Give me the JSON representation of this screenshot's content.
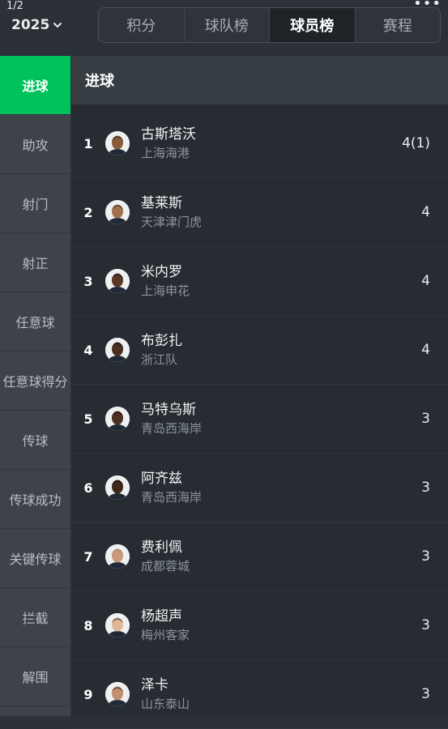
{
  "status": {
    "pager": "1/2",
    "more": "•••"
  },
  "season": {
    "year": "2025"
  },
  "tabs": [
    {
      "label": "积分"
    },
    {
      "label": "球队榜"
    },
    {
      "label": "球员榜"
    },
    {
      "label": "赛程"
    }
  ],
  "sidebar": {
    "items": [
      {
        "label": "进球"
      },
      {
        "label": "助攻"
      },
      {
        "label": "射门"
      },
      {
        "label": "射正"
      },
      {
        "label": "任意球"
      },
      {
        "label": "任意球得分"
      },
      {
        "label": "传球"
      },
      {
        "label": "传球成功"
      },
      {
        "label": "关键传球"
      },
      {
        "label": "拦截"
      },
      {
        "label": "解围"
      }
    ]
  },
  "section": {
    "title": "进球"
  },
  "players": [
    {
      "rank": "1",
      "name": "古斯塔沃",
      "team": "上海海港",
      "goals": "4(1)",
      "skin": "#8a5a3c",
      "hair": "#2a1d17"
    },
    {
      "rank": "2",
      "name": "基莱斯",
      "team": "天津津门虎",
      "goals": "4",
      "skin": "#a0704c",
      "hair": "#3b2a20"
    },
    {
      "rank": "3",
      "name": "米内罗",
      "team": "上海申花",
      "goals": "4",
      "skin": "#5a3726",
      "hair": "#1c120d"
    },
    {
      "rank": "4",
      "name": "布彭扎",
      "team": "浙江队",
      "goals": "4",
      "skin": "#4b2e20",
      "hair": "#120b08"
    },
    {
      "rank": "5",
      "name": "马特乌斯",
      "team": "青岛西海岸",
      "goals": "3",
      "skin": "#4e3022",
      "hair": "#140d09"
    },
    {
      "rank": "6",
      "name": "阿齐兹",
      "team": "青岛西海岸",
      "goals": "3",
      "skin": "#3f271c",
      "hair": "#100a07"
    },
    {
      "rank": "7",
      "name": "费利佩",
      "team": "成都蓉城",
      "goals": "3",
      "skin": "#c89878",
      "hair": "#b48466"
    },
    {
      "rank": "8",
      "name": "杨超声",
      "team": "梅州客家",
      "goals": "3",
      "skin": "#e0b898",
      "hair": "#1f1a18"
    },
    {
      "rank": "9",
      "name": "泽卡",
      "team": "山东泰山",
      "goals": "3",
      "skin": "#c48e6a",
      "hair": "#2e1f16"
    }
  ]
}
